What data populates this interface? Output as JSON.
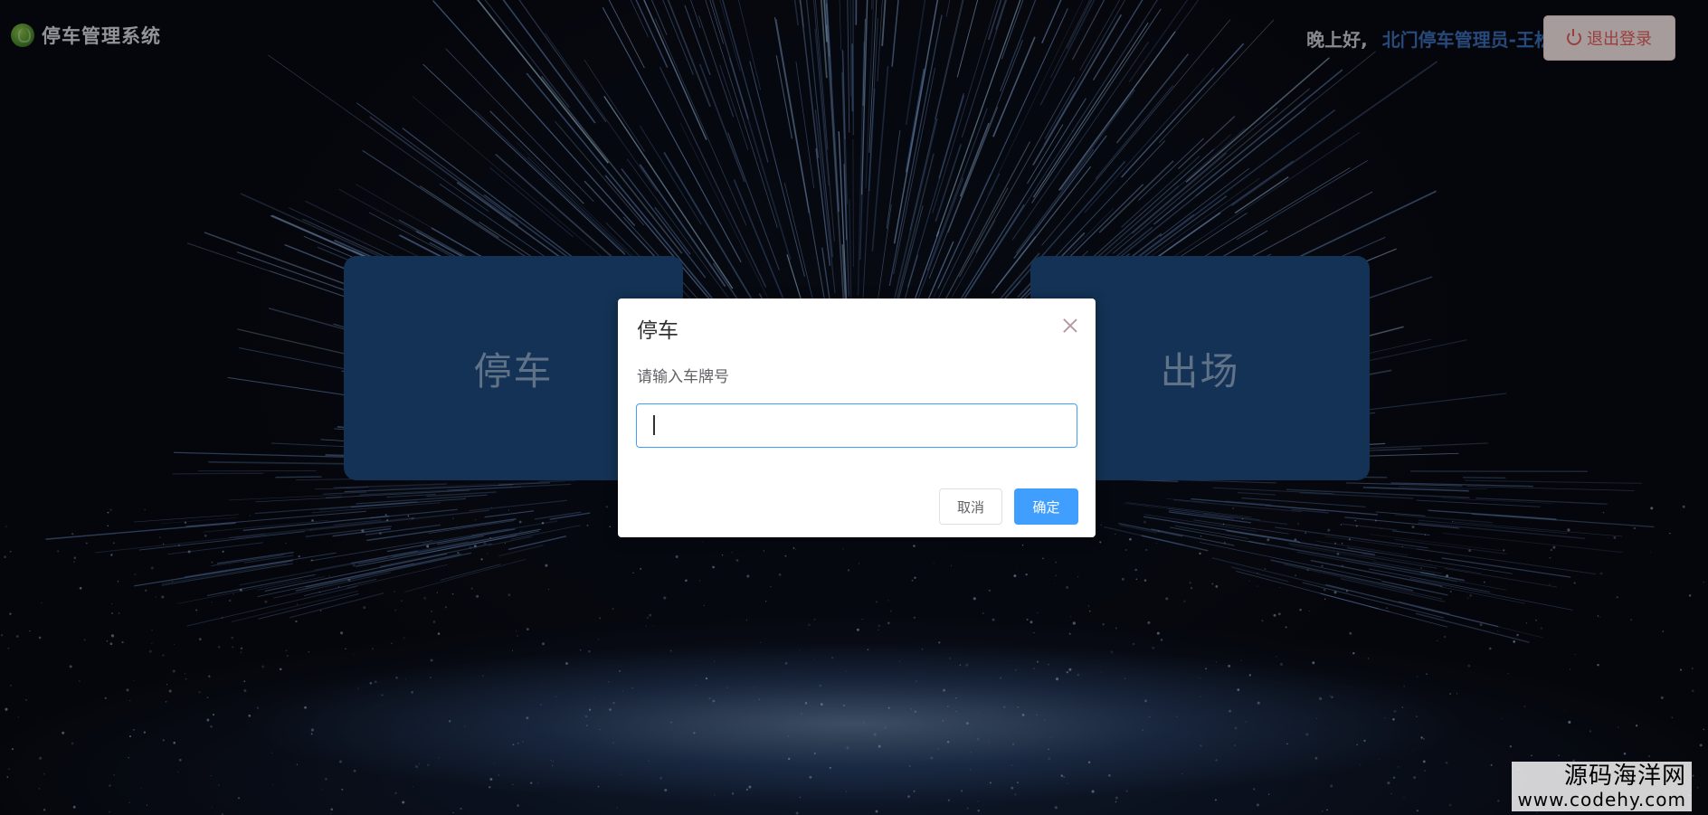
{
  "header": {
    "app_title": "停车管理系统",
    "greeting": "晚上好,",
    "user_name": "北门停车管理员-王松",
    "logout_label": "退出登录"
  },
  "cards": [
    {
      "label": "停车"
    },
    {
      "label": "出场"
    }
  ],
  "dialog": {
    "title": "停车",
    "message": "请输入车牌号",
    "input_value": "",
    "cancel_label": "取消",
    "confirm_label": "确定"
  },
  "watermark": {
    "site_name": "源码海洋网",
    "url": "www.codehy.com"
  },
  "colors": {
    "card_bg": "#1c4a7e",
    "primary": "#409eff",
    "logout_text": "#e25c5c",
    "user_name": "#3a6db5"
  }
}
